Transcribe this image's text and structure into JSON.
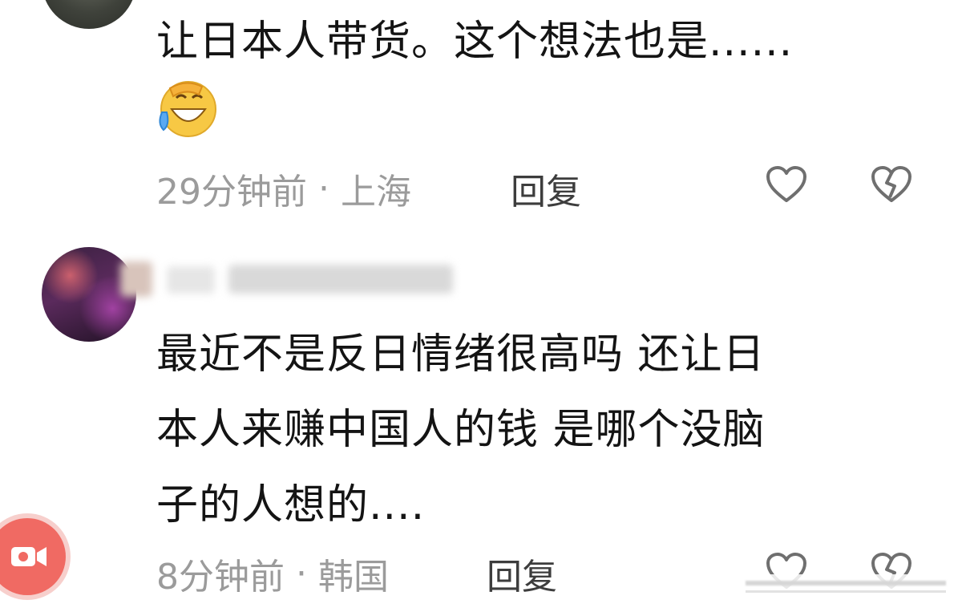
{
  "comments": [
    {
      "text_line1": "让日本人带货。这个想法也是......",
      "emoji": "laughing-crying-emoji",
      "time": "29分钟前",
      "location": "上海",
      "separator": "·",
      "reply_label": "回复"
    },
    {
      "text_lines": [
        "最近不是反日情绪很高吗 还让日",
        "本人来赚中国人的钱 是哪个没脑",
        "子的人想的...."
      ],
      "time": "8分钟前",
      "location": "韩国",
      "separator": "·",
      "reply_label": "回复"
    }
  ],
  "icons": {
    "like": "heart-outline-icon",
    "dislike": "broken-heart-icon",
    "video": "video-camera-icon"
  },
  "colors": {
    "text": "#141414",
    "meta": "#9b9b9b",
    "reply": "#3d3d3d",
    "icon": "#6f6f6f",
    "video_button": "#f06a63"
  }
}
